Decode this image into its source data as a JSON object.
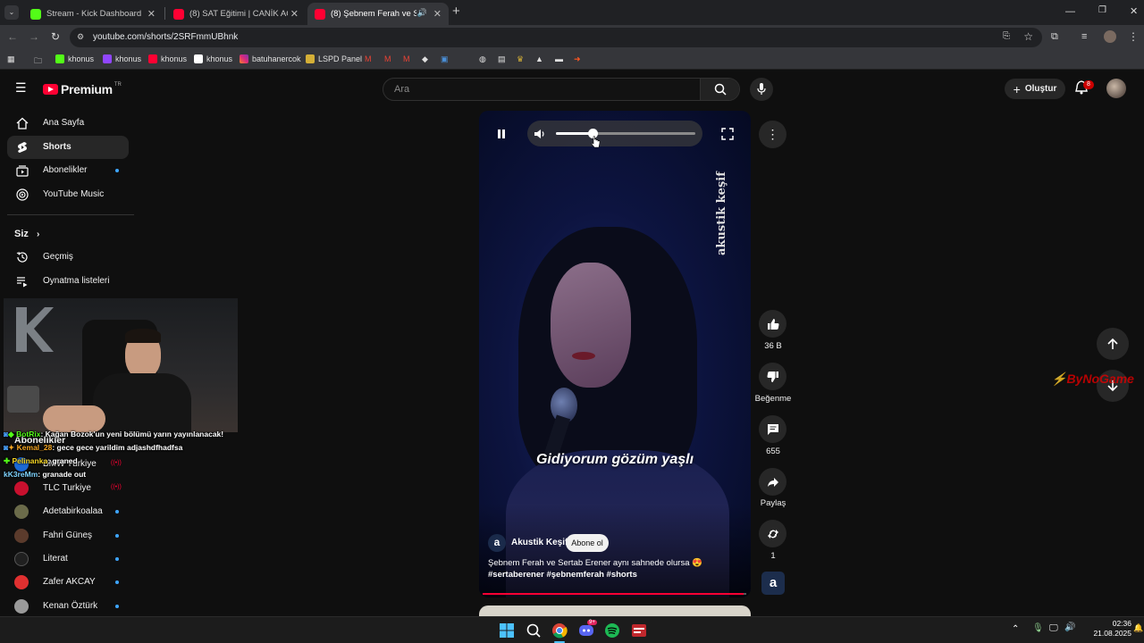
{
  "browser": {
    "tabs": [
      {
        "title": "Stream - Kick Dashboard",
        "icon": "kick-icon",
        "color": "#53fc18"
      },
      {
        "title": "(8) SAT Eğitimi | CANİK ACADEMY",
        "icon": "youtube-icon",
        "color": "#ff0033"
      },
      {
        "title": "(8) Şebnem Ferah ve Sertab",
        "icon": "youtube-icon",
        "color": "#ff0033",
        "active": true
      }
    ],
    "new_tab": "+",
    "url": "youtube.com/shorts/2SRFmmUBhnk",
    "bookmarks": [
      {
        "label": "khonus",
        "icon": "kick-icon"
      },
      {
        "label": "khonus",
        "icon": "twitch-icon"
      },
      {
        "label": "khonus",
        "icon": "youtube-icon"
      },
      {
        "label": "khonus",
        "icon": "x-icon"
      },
      {
        "label": "batuhanercok",
        "icon": "instagram-icon"
      },
      {
        "label": "LSPD Panel",
        "icon": "lspd-icon"
      }
    ]
  },
  "youtube": {
    "logo_text": "Premium",
    "logo_region": "TR",
    "search_placeholder": "Ara",
    "create_label": "Oluştur",
    "notification_count": "8"
  },
  "sidebar": {
    "items": [
      {
        "label": "Ana Sayfa",
        "icon": "home-icon"
      },
      {
        "label": "Shorts",
        "icon": "shorts-icon",
        "active": true
      },
      {
        "label": "Abonelikler",
        "icon": "subscriptions-icon",
        "dot": true
      },
      {
        "label": "YouTube Music",
        "icon": "music-icon"
      }
    ],
    "you_heading": "Siz",
    "you_items": [
      {
        "label": "Geçmiş",
        "icon": "history-icon"
      },
      {
        "label": "Oynatma listeleri",
        "icon": "playlists-icon"
      }
    ],
    "subs_heading": "Abonelikler",
    "subscriptions": [
      {
        "name": "BMW Türkiye",
        "live": true
      },
      {
        "name": "TLC Turkiye",
        "live": true
      },
      {
        "name": "Adetabirkoalaa",
        "dot": true
      },
      {
        "name": "Fahri Güneş",
        "dot": true
      },
      {
        "name": "Literat",
        "dot": true
      },
      {
        "name": "Zafer AKCAY",
        "dot": true
      },
      {
        "name": "Kenan Öztürk",
        "dot": true
      }
    ]
  },
  "stream_chat": [
    {
      "user": "BotRix",
      "user_color": "#53fc18",
      "message": ": Kağan Bozok'un yeni bölümü yarın yayınlanacak!"
    },
    {
      "user": "Kemal_28",
      "user_color": "#f5a623",
      "message": ": gece gece yarildim adjashdfhadfsa"
    },
    {
      "user": "Pelinanka",
      "user_color": "#f5d423",
      "message": ": graned"
    },
    {
      "user": "kK3reMm",
      "user_color": "#7fd3ff",
      "message": ": granade out"
    }
  ],
  "short": {
    "watermark": "akustik keşif",
    "subtitle": "Gidiyorum gözüm yaşlı",
    "channel_name": "Akustik Keşif",
    "channel_logo": "a",
    "subscribe_label": "Abone ol",
    "description": "Şebnem Ferah ve Sertab Erener aynı sahnede olursa 😍",
    "hashtags": "#sertaberener #şebnemferah #shorts",
    "volume": 0.26,
    "progress": 0.99,
    "actions": {
      "likes": "36 B",
      "dislike_label": "Beğenme",
      "comments": "655",
      "share_label": "Paylaş",
      "remix_count": "1"
    }
  },
  "overlay_brand": "ByNoGame",
  "taskbar": {
    "time": "02:36",
    "date": "21.08.2025",
    "discord_badge": "9+"
  }
}
